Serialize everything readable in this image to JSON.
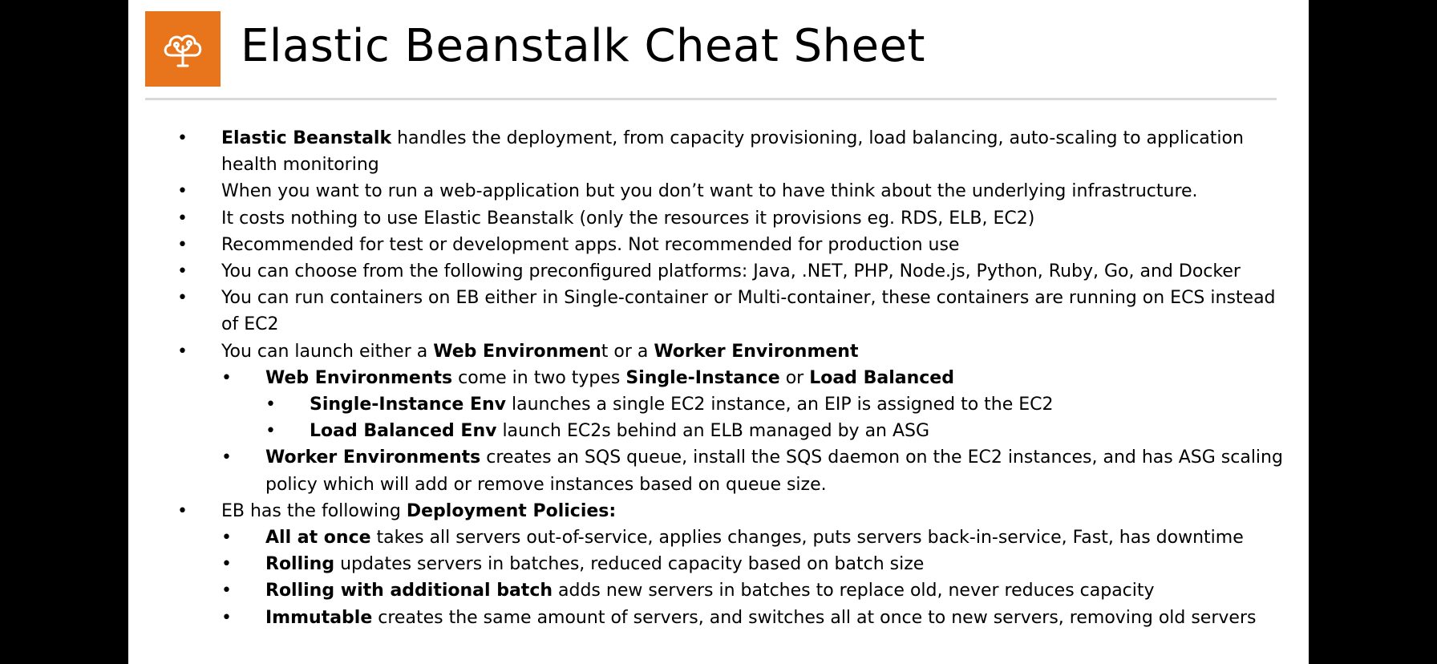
{
  "slide": {
    "title": "Elastic Beanstalk Cheat Sheet",
    "logo_icon": "elastic-beanstalk-icon",
    "logo_color": "#e8741c"
  },
  "bullets": [
    {
      "level": 1,
      "segments": [
        {
          "text": "Elastic Beanstalk",
          "bold": true
        },
        {
          "text": " handles the deployment, from capacity provisioning, load balancing, auto-scaling to application health monitoring",
          "bold": false
        }
      ]
    },
    {
      "level": 1,
      "segments": [
        {
          "text": "When you want to run a web-application but you don’t want to have think about the underlying infrastructure.",
          "bold": false
        }
      ]
    },
    {
      "level": 1,
      "segments": [
        {
          "text": "It costs nothing to use Elastic Beanstalk (only the resources it provisions eg. RDS, ELB, EC2)",
          "bold": false
        }
      ]
    },
    {
      "level": 1,
      "segments": [
        {
          "text": "Recommended for test or development apps. Not recommended for production use",
          "bold": false
        }
      ]
    },
    {
      "level": 1,
      "segments": [
        {
          "text": "You can choose from the following preconfigured platforms: Java, .NET, PHP, Node.js, Python, Ruby, Go, and Docker",
          "bold": false
        }
      ]
    },
    {
      "level": 1,
      "segments": [
        {
          "text": "You can run containers on EB either in Single-container or Multi-container, these containers are running on ECS instead of EC2",
          "bold": false
        }
      ]
    },
    {
      "level": 1,
      "segments": [
        {
          "text": "You can launch either a ",
          "bold": false
        },
        {
          "text": "Web Environmen",
          "bold": true
        },
        {
          "text": "t or a ",
          "bold": false
        },
        {
          "text": "Worker Environment",
          "bold": true
        }
      ]
    },
    {
      "level": 2,
      "segments": [
        {
          "text": "Web Environments",
          "bold": true
        },
        {
          "text": " come in two types ",
          "bold": false
        },
        {
          "text": "Single-Instance",
          "bold": true
        },
        {
          "text": " or ",
          "bold": false
        },
        {
          "text": "Load Balanced",
          "bold": true
        }
      ]
    },
    {
      "level": 3,
      "segments": [
        {
          "text": "Single-Instance Env",
          "bold": true
        },
        {
          "text": " launches a single EC2 instance, an EIP is assigned to the EC2",
          "bold": false
        }
      ]
    },
    {
      "level": 3,
      "segments": [
        {
          "text": "Load Balanced Env",
          "bold": true
        },
        {
          "text": " launch EC2s behind an ELB managed by an ASG",
          "bold": false
        }
      ]
    },
    {
      "level": 2,
      "segments": [
        {
          "text": "Worker Environments",
          "bold": true
        },
        {
          "text": " creates an SQS queue, install the SQS daemon on the EC2 instances, and has ASG scaling policy which will add or remove instances based on queue size.",
          "bold": false
        }
      ]
    },
    {
      "level": 1,
      "segments": [
        {
          "text": "EB has the following ",
          "bold": false
        },
        {
          "text": "Deployment Policies:",
          "bold": true
        }
      ]
    },
    {
      "level": 2,
      "segments": [
        {
          "text": "All at once",
          "bold": true
        },
        {
          "text": " takes all servers out-of-service, applies changes, puts servers back-in-service, Fast, has downtime",
          "bold": false
        }
      ]
    },
    {
      "level": 2,
      "segments": [
        {
          "text": "Rolling",
          "bold": true
        },
        {
          "text": " updates servers in batches, reduced capacity based on batch size",
          "bold": false
        }
      ]
    },
    {
      "level": 2,
      "segments": [
        {
          "text": "Rolling with additional batch",
          "bold": true
        },
        {
          "text": "  adds new servers in batches to replace old, never reduces capacity",
          "bold": false
        }
      ]
    },
    {
      "level": 2,
      "segments": [
        {
          "text": "Immutable",
          "bold": true
        },
        {
          "text": " creates the same amount of servers, and switches all at once to new servers, removing old servers",
          "bold": false
        }
      ]
    }
  ]
}
